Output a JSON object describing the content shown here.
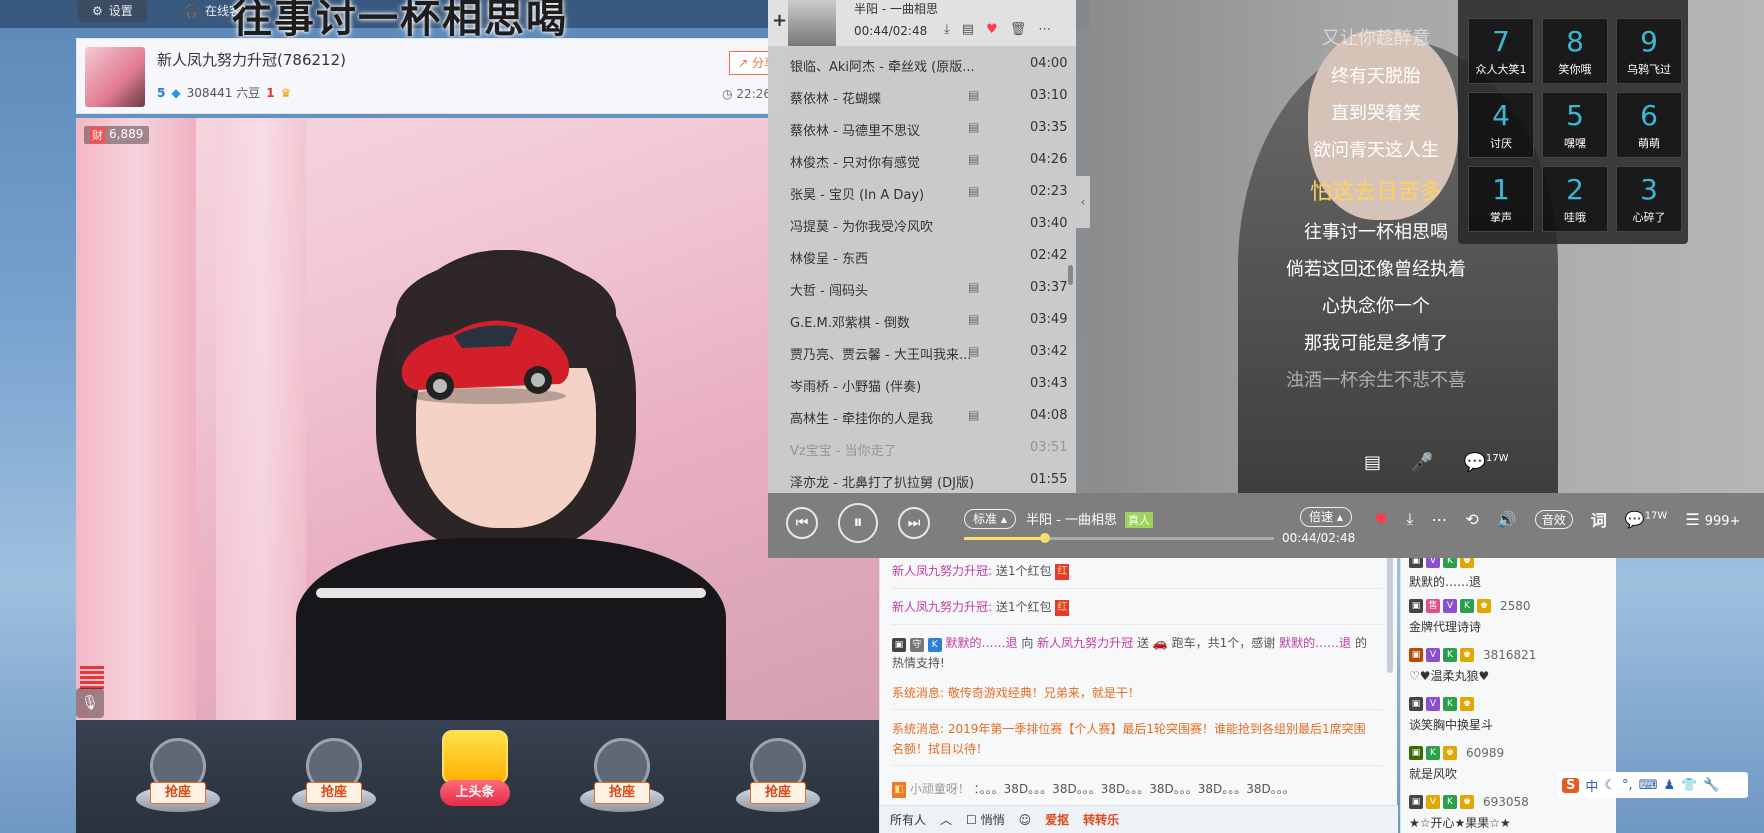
{
  "topbar": {
    "settings_label": "设置",
    "online_label": "在线客",
    "overlay_title": "往事讨一杯相思喝"
  },
  "room": {
    "name": "新人凤九努力升冠(786212)",
    "level": "5",
    "liubi": "308441 六豆",
    "crown": "1",
    "share_label": "分享",
    "time": "22:26"
  },
  "video": {
    "fan_count": "6,889",
    "cai_label": "财"
  },
  "seats": {
    "grab_label": "抢座",
    "headline_label": "上头条"
  },
  "chat": {
    "messages": [
      {
        "user": "新人凤九努力升冠:",
        "text": "送1个红包"
      },
      {
        "user": "新人凤九努力升冠:",
        "text": "送1个红包"
      },
      {
        "user": "默默的……退",
        "text": "向",
        "target": "新人凤九努力升冠",
        "text2": "送",
        "gift": "跑车，共1个，感谢",
        "user2": "默默的……退",
        "text3": "的热情支持!"
      },
      {
        "sys": "系统消息: 敬传奇游戏经典！兄弟来，就是干！"
      },
      {
        "sys": "系统消息: 2019年第一季排位赛【个人赛】最后1轮突围赛！谁能抢到各组别最后1席突围名额！拭目以待！"
      },
      {
        "user": "小顽童呀！",
        "text": "：。。。38D。。。38D。。。38D。。。38D。。。38D。。。38D。。。"
      }
    ],
    "bottom": {
      "audience": "所有人",
      "whisper": "悄悄",
      "gift1": "爱抠",
      "gift2": "转转乐"
    }
  },
  "audience": [
    {
      "num": "",
      "name": "默默的……退"
    },
    {
      "num": "2580",
      "name": "金牌代理诗诗"
    },
    {
      "num": "3816821",
      "name": "♡♥温柔丸狼♥"
    },
    {
      "num": "",
      "name": "谈笑胸中换星斗"
    },
    {
      "num": "60989",
      "name": "就是风吹"
    },
    {
      "num": "693058",
      "name": "★☆开心★果果☆★"
    }
  ],
  "player": {
    "header_song": "半阳 - 一曲相思",
    "header_time": "00:44/02:48",
    "playlist": [
      {
        "title": "银临、Aki阿杰 - 牵丝戏 (原版...",
        "mv": false,
        "dur": "04:00"
      },
      {
        "title": "蔡依林 - 花蝴蝶",
        "mv": true,
        "dur": "03:10"
      },
      {
        "title": "蔡依林 - 马德里不思议",
        "mv": true,
        "dur": "03:35"
      },
      {
        "title": "林俊杰 - 只对你有感觉",
        "mv": true,
        "dur": "04:26"
      },
      {
        "title": "张昊 - 宝贝 (In A Day)",
        "mv": true,
        "dur": "02:23"
      },
      {
        "title": "冯提莫 - 为你我受冷风吹",
        "mv": false,
        "dur": "03:40"
      },
      {
        "title": "林俊呈 - 东西",
        "mv": false,
        "dur": "02:42"
      },
      {
        "title": "大哲 - 闯码头",
        "mv": true,
        "dur": "03:37"
      },
      {
        "title": "G.E.M.邓紫棋 - 倒数",
        "mv": true,
        "dur": "03:49"
      },
      {
        "title": "贾乃亮、贾云馨 - 大王叫我来...",
        "mv": true,
        "dur": "03:42"
      },
      {
        "title": "岑雨桥 - 小野猫 (伴奏)",
        "mv": false,
        "dur": "03:43"
      },
      {
        "title": "高林生 - 牵挂你的人是我",
        "mv": true,
        "dur": "04:08"
      },
      {
        "title": "Vz宝宝 - 当你走了",
        "mv": false,
        "dur": "03:51"
      },
      {
        "title": "泽亦龙 - 北鼻打了扒拉舅 (DJ版)",
        "mv": false,
        "dur": "01:55"
      }
    ],
    "lyrics": [
      "又让你趁醉意",
      "终有天脱胎",
      "直到哭着笑",
      "欲问青天这人生",
      "怕这去日苦多",
      "往事讨一杯相思喝",
      "倘若这回还像曾经执着",
      "心执念你一个",
      "那我可能是多情了",
      "浊酒一杯余生不悲不喜"
    ],
    "comment_count": "17W",
    "speed_label": "标准",
    "now_playing": "半阳 - 一曲相思",
    "real_badge": "真人",
    "progress": 0.262,
    "ctrl_time": "00:44/02:48",
    "rate_label": "倍速",
    "sound_label": "音效",
    "lyric_btn": "词",
    "comments_ctrl": "17W",
    "list_count": "999+"
  },
  "gifts": [
    {
      "n": "7",
      "name": "众人大笑1"
    },
    {
      "n": "8",
      "name": "笑你哦"
    },
    {
      "n": "9",
      "name": "乌鸦飞过"
    },
    {
      "n": "4",
      "name": "讨厌"
    },
    {
      "n": "5",
      "name": "嘿嘿"
    },
    {
      "n": "6",
      "name": "萌萌"
    },
    {
      "n": "1",
      "name": "掌声"
    },
    {
      "n": "2",
      "name": "哇哦"
    },
    {
      "n": "3",
      "name": "心碎了"
    }
  ],
  "tray": {
    "s_label": "S",
    "zh_label": "中"
  }
}
